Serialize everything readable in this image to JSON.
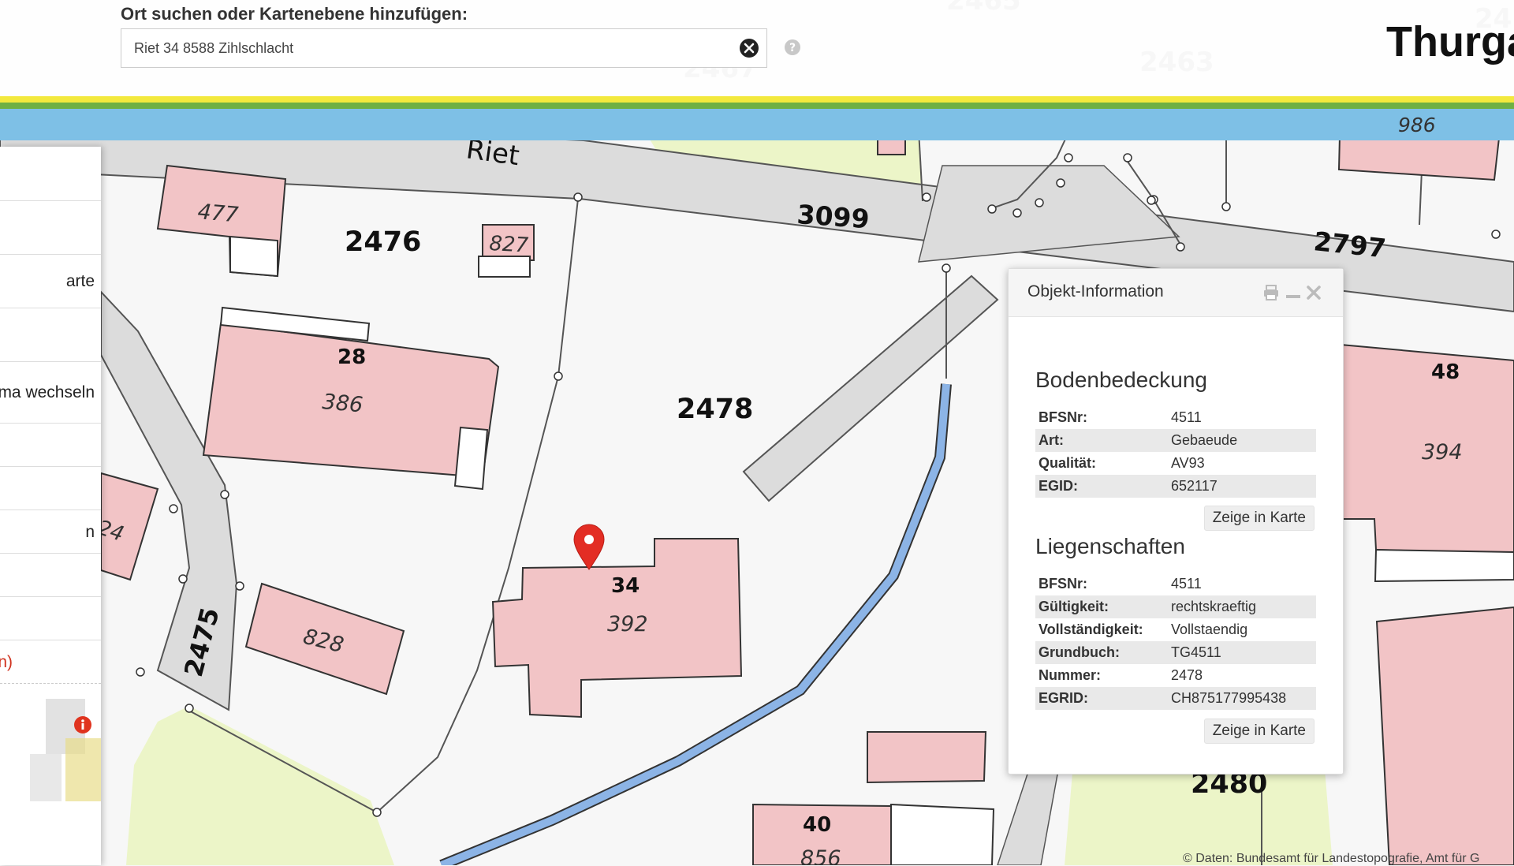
{
  "header": {
    "search_label": "Ort suchen oder Kartenebene hinzufügen:",
    "search_value": "Riet 34 8588 Zihlschlacht",
    "brand": "Thurga"
  },
  "icons": {
    "clear": "clear-circle-x-icon",
    "help": "question-circle-icon",
    "print": "print-icon",
    "minimize": "minimize-icon",
    "close": "close-icon",
    "marker": "location-marker-icon",
    "info": "info-circle-icon"
  },
  "colors": {
    "building": "#f2c4c6",
    "street": "#dcdcdc",
    "meadow": "#ecf5c8",
    "marker": "#e32d24",
    "stream": "#8cb4e6",
    "stripe_yellow": "#f3e93d",
    "stripe_green": "#6eb043",
    "stripe_blue": "#7ec0e6"
  },
  "left_panel": {
    "items": [
      "arte",
      "ma wechseln",
      "n",
      "n)"
    ]
  },
  "map": {
    "street_name": "Riet",
    "parcels": [
      "2476",
      "3099",
      "2797",
      "2478",
      "2475",
      "2480",
      "2463",
      "2465",
      "2467",
      "24"
    ],
    "buildings": [
      "477",
      "827",
      "386",
      "828",
      "392",
      "394",
      "986",
      "856",
      "24"
    ],
    "addresses": [
      "28",
      "34",
      "48",
      "40"
    ]
  },
  "popup": {
    "title": "Objekt-Information",
    "sections": [
      {
        "title": "Bodenbedeckung",
        "rows": [
          {
            "key": "BFSNr:",
            "value": "4511"
          },
          {
            "key": "Art:",
            "value": "Gebaeude"
          },
          {
            "key": "Qualität:",
            "value": "AV93"
          },
          {
            "key": "EGID:",
            "value": "652117"
          }
        ],
        "button": "Zeige in Karte"
      },
      {
        "title": "Liegenschaften",
        "rows": [
          {
            "key": "BFSNr:",
            "value": "4511"
          },
          {
            "key": "Gültigkeit:",
            "value": "rechtskraeftig"
          },
          {
            "key": "Vollständigkeit:",
            "value": "Vollstaendig"
          },
          {
            "key": "Grundbuch:",
            "value": "TG4511"
          },
          {
            "key": "Nummer:",
            "value": "2478"
          },
          {
            "key": "EGRID:",
            "value": "CH875177995438"
          }
        ],
        "button": "Zeige in Karte"
      }
    ]
  },
  "attribution": "© Daten: Bundesamt für Landestopografie, Amt für G"
}
